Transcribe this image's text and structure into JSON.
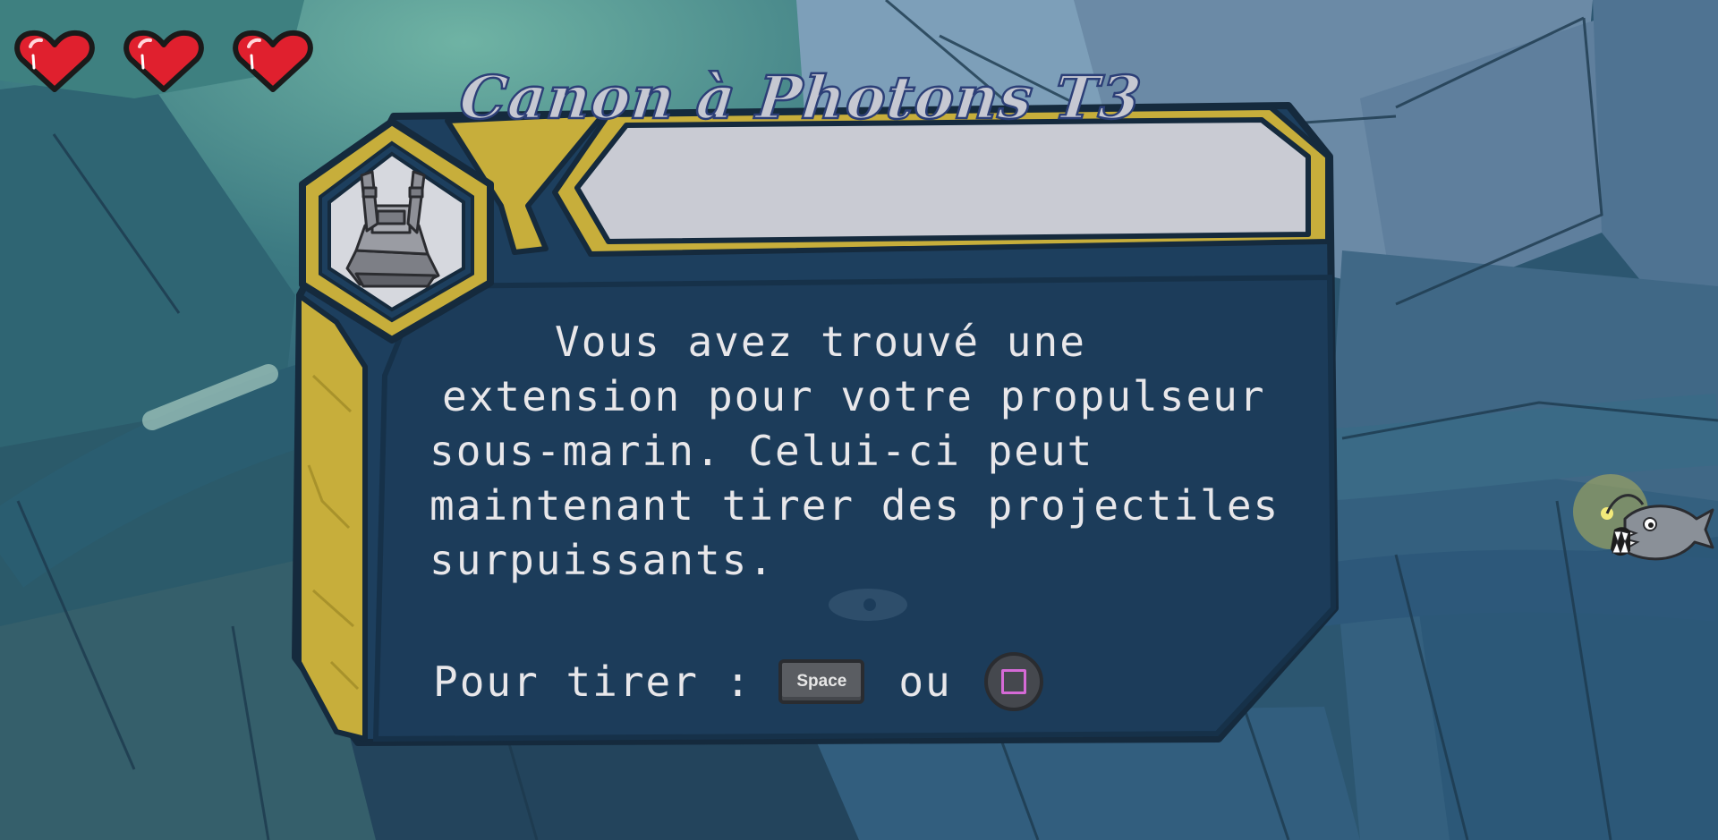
{
  "hud": {
    "lives": 3,
    "icons": [
      "heart-icon",
      "heart-icon",
      "heart-icon"
    ]
  },
  "dialog": {
    "title": "Canon à Photons T3",
    "item_icon": "photon-cannon-turret-icon",
    "body_lines": [
      "Vous avez trouvé une",
      "extension pour votre propulseur",
      "sous-marin. Celui-ci peut",
      "maintenant tirer des projectiles",
      "surpuissants."
    ],
    "fire_label": "Pour tirer :",
    "key_label": "Space",
    "or_label": "ou",
    "gamepad_button": "square-button-icon"
  },
  "enemy": {
    "icon": "anglerfish-icon"
  },
  "colors": {
    "panel": "#1d3f5e",
    "panel_border": "#152a3d",
    "gold": "#c7ae3b",
    "title_plate": "#c9cbd3",
    "title_text": "#c6c8d2",
    "title_outline": "#2c3f77",
    "heart": "#e0202e",
    "ps_square": "#d56ad6"
  }
}
